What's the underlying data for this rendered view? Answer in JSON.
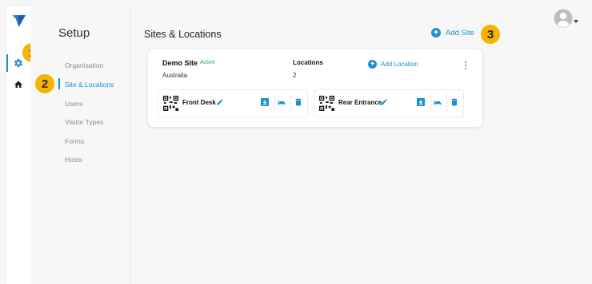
{
  "nav": {
    "title": "Setup",
    "items": [
      "Organisation",
      "Site & Locations",
      "Users",
      "Visitor Types",
      "Forms",
      "Hosts"
    ],
    "active_index": 1
  },
  "header": {
    "page_title": "Sites & Locations",
    "add_site_label": "Add Site"
  },
  "badges": [
    "1",
    "2",
    "3"
  ],
  "site": {
    "name": "Demo Site",
    "status": "Active",
    "country": "Australia",
    "locations_label": "Locations",
    "locations_count": "2",
    "add_location_label": "Add Location",
    "locations": [
      {
        "name": "Front Desk"
      },
      {
        "name": "Rear Entrance"
      }
    ]
  },
  "colors": {
    "accent": "#1a8fd1",
    "active_status": "#31a84a",
    "badge": "#f4b400",
    "logo_blue": "#1b5fab",
    "logo_teal": "#19b0c6"
  },
  "icons": [
    "logo",
    "gear-icon",
    "home-icon",
    "plus-circle-icon",
    "avatar-icon",
    "kebab-icon",
    "qr-code-icon",
    "edit-pencil-icon",
    "download-icon",
    "bed-icon",
    "trash-icon"
  ]
}
